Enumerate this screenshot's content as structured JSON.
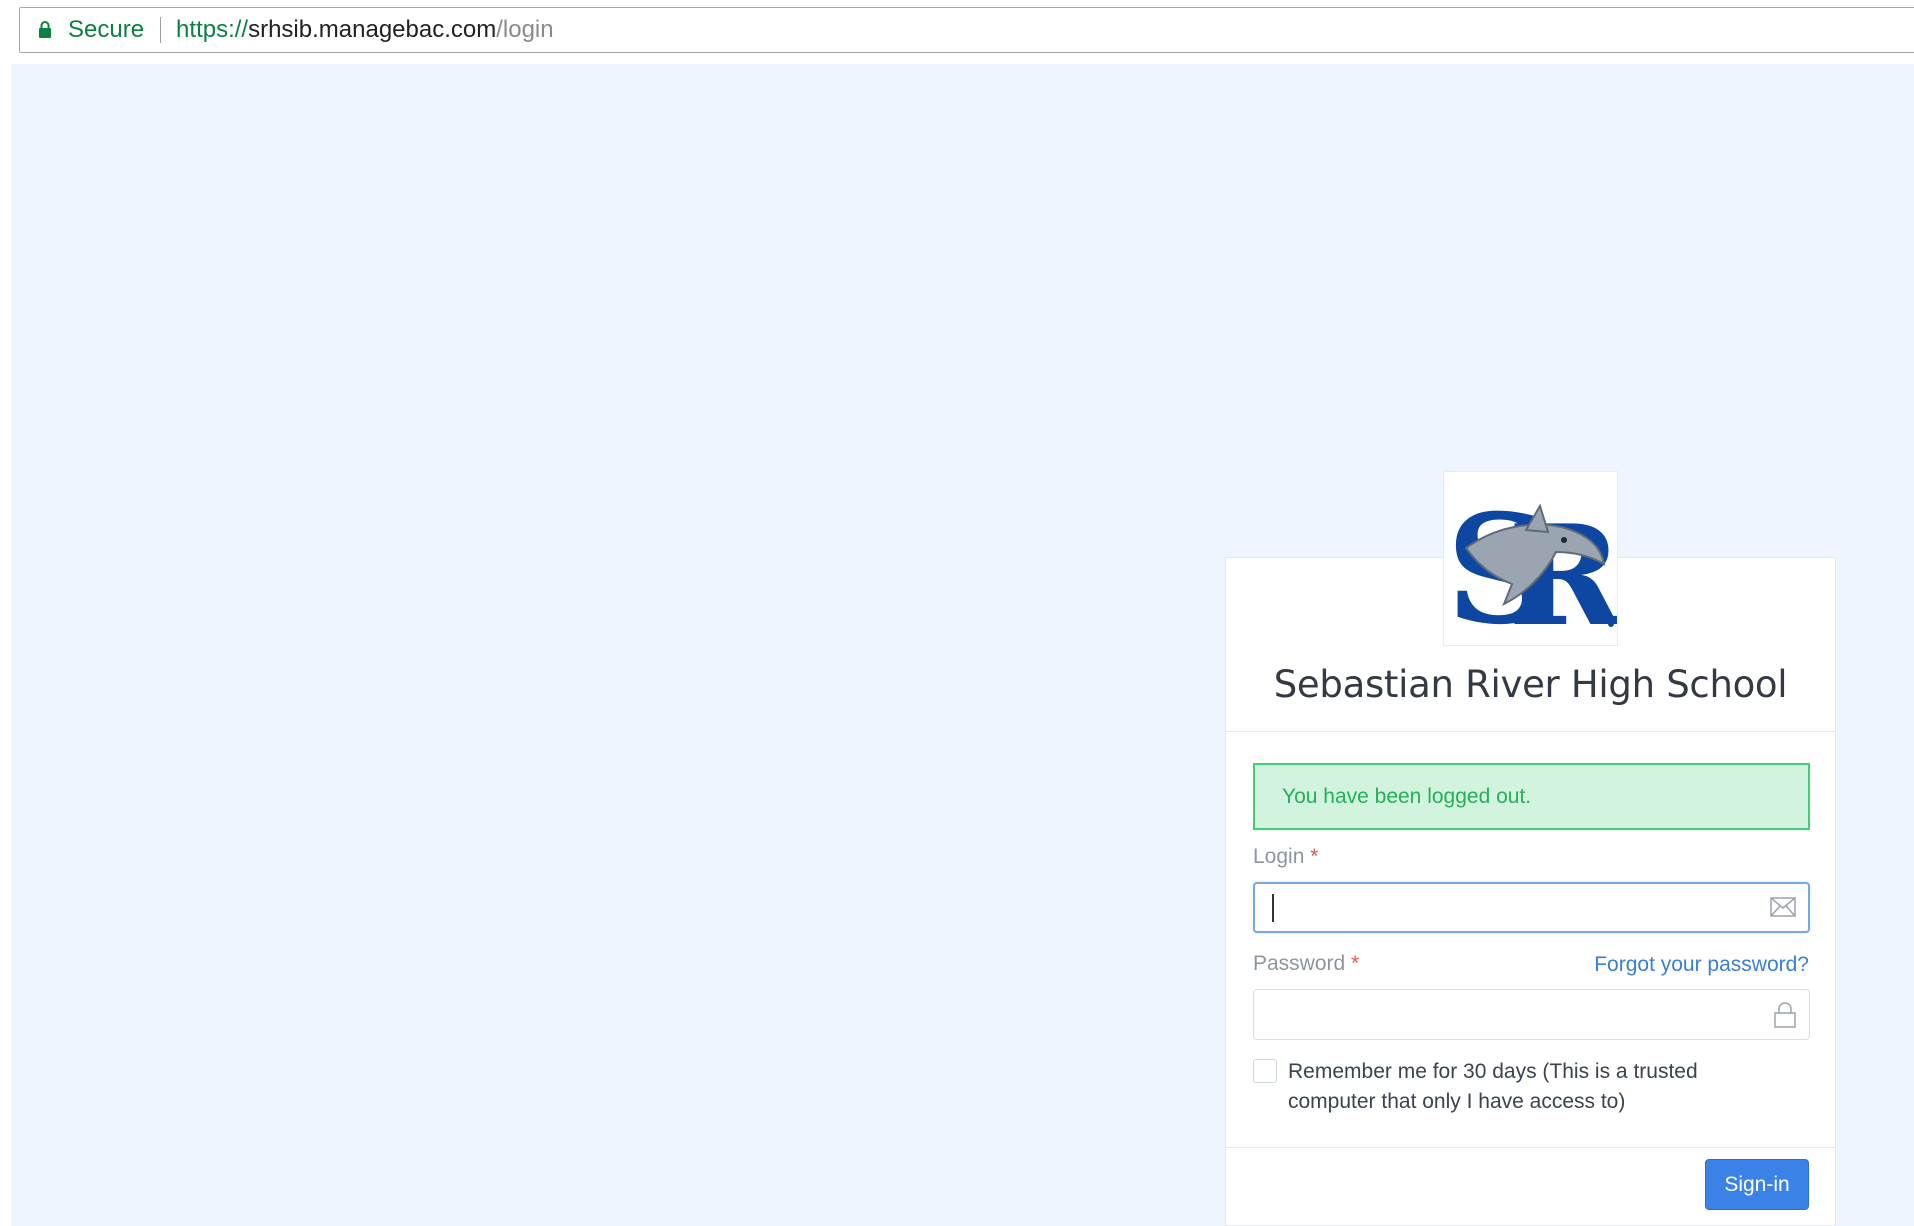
{
  "browser": {
    "secure_label": "Secure",
    "url_protocol": "https://",
    "url_host": "srhsib.managebac.com",
    "url_path": "/login",
    "lock_icon": "lock-icon"
  },
  "logo": {
    "icon": "school-logo-sr-shark",
    "primary_color": "#0d47a1",
    "secondary_color": "#9aa5b1"
  },
  "login_card": {
    "school_name": "Sebastian River High School",
    "alert_message": "You have been logged out.",
    "login_label": "Login",
    "login_value": "",
    "login_icon": "envelope-icon",
    "password_label": "Password",
    "password_value": "",
    "password_icon": "lock-icon",
    "required_marker": "*",
    "forgot_link": "Forgot your password?",
    "remember_checked": false,
    "remember_text": "Remember me for 30 days (This is a trusted computer that only I have access to)",
    "signin_label": "Sign-in"
  },
  "colors": {
    "page_background": "#eef5fe",
    "alert_background": "#d2f3de",
    "alert_border": "#3fcf74",
    "link": "#3a7fd5",
    "button": "#3b82e6"
  }
}
